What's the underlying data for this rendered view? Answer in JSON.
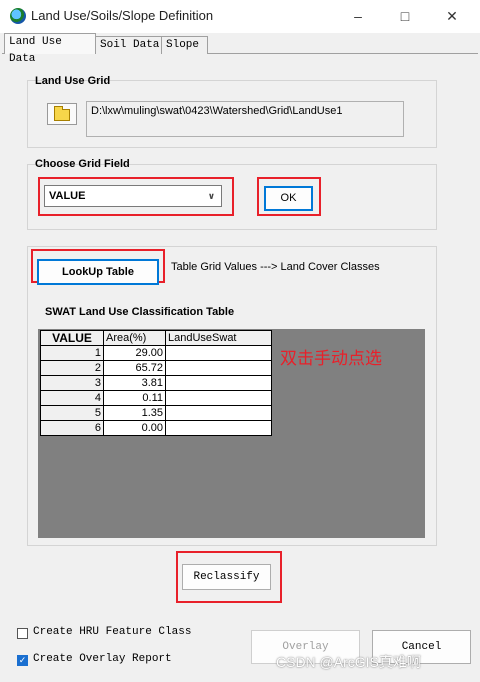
{
  "window": {
    "title": "Land Use/Soils/Slope Definition"
  },
  "tabs": [
    {
      "label": "Land Use Data"
    },
    {
      "label": "Soil Data"
    },
    {
      "label": "Slope"
    }
  ],
  "land_use_grid": {
    "label": "Land Use Grid",
    "path": "D:\\lxw\\muling\\swat\\0423\\Watershed\\Grid\\LandUse1"
  },
  "grid_field": {
    "label": "Choose Grid Field",
    "selected": "VALUE",
    "ok_label": "OK"
  },
  "lookup": {
    "button_label": "LookUp Table",
    "description": "Table Grid Values ---> Land Cover Classes"
  },
  "classification": {
    "title": "SWAT Land Use Classification Table",
    "columns": [
      "VALUE",
      "Area(%)",
      "LandUseSwat"
    ],
    "rows": [
      {
        "value": "1",
        "area": "29.00",
        "landuse": ""
      },
      {
        "value": "2",
        "area": "65.72",
        "landuse": ""
      },
      {
        "value": "3",
        "area": "3.81",
        "landuse": ""
      },
      {
        "value": "4",
        "area": "0.11",
        "landuse": ""
      },
      {
        "value": "5",
        "area": "1.35",
        "landuse": ""
      },
      {
        "value": "6",
        "area": "0.00",
        "landuse": ""
      }
    ],
    "annotation": "双击手动点选"
  },
  "reclassify_label": "Reclassify",
  "options": {
    "create_hru": {
      "label": "Create HRU Feature Class",
      "checked": false
    },
    "create_overlay": {
      "label": "Create Overlay Report",
      "checked": true
    }
  },
  "footer": {
    "overlay_label": "Overlay",
    "cancel_label": "Cancel",
    "watermark": "CSDN @ArcGIS真难啊"
  },
  "colors": {
    "annotation_red": "#e8202a",
    "grid_background": "#808080",
    "focus_blue": "#0078d7"
  },
  "icons": {
    "app": "globe-icon",
    "folder": "folder-icon",
    "minimize": "minimize-icon",
    "maximize": "maximize-icon",
    "close": "close-icon",
    "dropdown": "chevron-down-icon",
    "check": "check-icon"
  }
}
